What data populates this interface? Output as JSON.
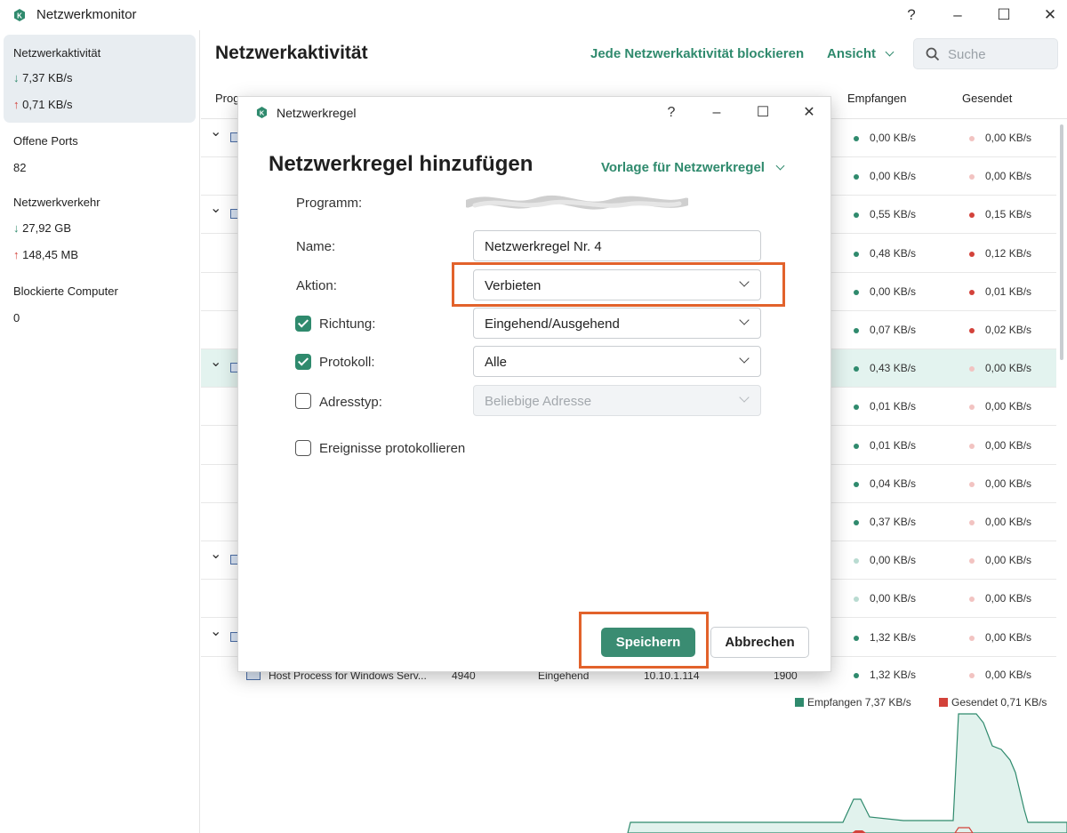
{
  "window": {
    "title": "Netzwerkmonitor",
    "help": "?",
    "minimize": "–",
    "maximize": "☐",
    "close": "✕"
  },
  "sidebar": {
    "activity_label": "Netzwerkaktivität",
    "activity_down": "7,37 KB/s",
    "activity_up": "0,71 KB/s",
    "ports_label": "Offene Ports",
    "ports_value": "82",
    "traffic_label": "Netzwerkverkehr",
    "traffic_down": "27,92 GB",
    "traffic_up": "148,45 MB",
    "blocked_label": "Blockierte Computer",
    "blocked_value": "0"
  },
  "header": {
    "title": "Netzwerkaktivität",
    "block_all": "Jede Netzwerkaktivität blockieren",
    "view": "Ansicht",
    "search_placeholder": "Suche"
  },
  "table": {
    "columns": {
      "program": "Prog",
      "received": "Empfangen",
      "sent": "Gesendet"
    },
    "rows": [
      {
        "received": "0,00 KB/s",
        "sent": "0,00 KB/s",
        "recv_color": "#2f8a6d",
        "sent_color": "#f2c3c1"
      },
      {
        "received": "0,00 KB/s",
        "sent": "0,00 KB/s",
        "recv_color": "#2f8a6d",
        "sent_color": "#f2c3c1"
      },
      {
        "received": "0,55 KB/s",
        "sent": "0,15 KB/s",
        "recv_color": "#2f8a6d",
        "sent_color": "#d3423a"
      },
      {
        "received": "0,48 KB/s",
        "sent": "0,12 KB/s",
        "recv_color": "#2f8a6d",
        "sent_color": "#d3423a"
      },
      {
        "received": "0,00 KB/s",
        "sent": "0,01 KB/s",
        "recv_color": "#2f8a6d",
        "sent_color": "#d3423a"
      },
      {
        "received": "0,07 KB/s",
        "sent": "0,02 KB/s",
        "recv_color": "#2f8a6d",
        "sent_color": "#d3423a"
      },
      {
        "received": "0,43 KB/s",
        "sent": "0,00 KB/s",
        "recv_color": "#2f8a6d",
        "sent_color": "#f2c3c1"
      },
      {
        "received": "0,01 KB/s",
        "sent": "0,00 KB/s",
        "recv_color": "#2f8a6d",
        "sent_color": "#f2c3c1"
      },
      {
        "received": "0,01 KB/s",
        "sent": "0,00 KB/s",
        "recv_color": "#2f8a6d",
        "sent_color": "#f2c3c1"
      },
      {
        "received": "0,04 KB/s",
        "sent": "0,00 KB/s",
        "recv_color": "#2f8a6d",
        "sent_color": "#f2c3c1"
      },
      {
        "received": "0,37 KB/s",
        "sent": "0,00 KB/s",
        "recv_color": "#2f8a6d",
        "sent_color": "#f2c3c1"
      },
      {
        "received": "0,00 KB/s",
        "sent": "0,00 KB/s",
        "recv_color": "#b9dbd1",
        "sent_color": "#f2c3c1"
      },
      {
        "received": "0,00 KB/s",
        "sent": "0,00 KB/s",
        "recv_color": "#b9dbd1",
        "sent_color": "#f2c3c1"
      },
      {
        "received": "1,32 KB/s",
        "sent": "0,00 KB/s",
        "recv_color": "#2f8a6d",
        "sent_color": "#f2c3c1"
      },
      {
        "received": "1,32 KB/s",
        "sent": "0,00 KB/s",
        "recv_color": "#2f8a6d",
        "sent_color": "#f2c3c1"
      }
    ],
    "last_row": {
      "program": "Host Process for Windows Serv...",
      "pid": "4940",
      "direction": "Eingehend",
      "remote_ip": "10.10.1.114",
      "local_port": "1900"
    }
  },
  "chart_legend": {
    "received": "Empfangen 7,37 KB/s",
    "sent": "Gesendet 0,71 KB/s",
    "received_color": "#2f8a6d",
    "sent_color": "#d3423a"
  },
  "dialog": {
    "title": "Netzwerkregel",
    "heading": "Netzwerkregel hinzufügen",
    "template": "Vorlage für Netzwerkregel",
    "program_label": "Programm:",
    "name_label": "Name:",
    "name_value": "Netzwerkregel Nr. 4",
    "action_label": "Aktion:",
    "action_value": "Verbieten",
    "direction_label": "Richtung:",
    "direction_value": "Eingehend/Ausgehend",
    "protocol_label": "Protokoll:",
    "protocol_value": "Alle",
    "addresstype_label": "Adresstyp:",
    "addresstype_value": "Beliebige Adresse",
    "log_label": "Ereignisse protokollieren",
    "save": "Speichern",
    "cancel": "Abbrechen"
  }
}
